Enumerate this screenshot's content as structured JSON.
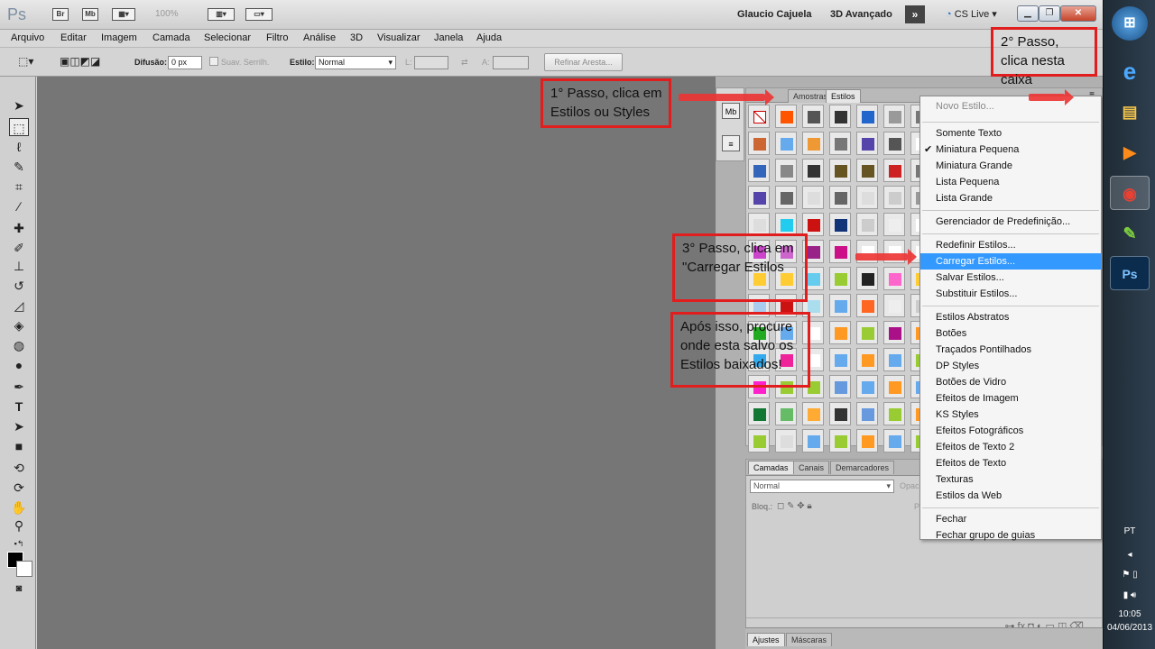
{
  "titlebar": {
    "app_logo": "Ps",
    "bridge": "Br",
    "minibridge": "Mb",
    "zoom": "100%",
    "user": "Glaucio Cajuela",
    "workspace": "3D Avançado",
    "more": "»",
    "cslive": "CS Live"
  },
  "menubar": [
    "Arquivo",
    "Editar",
    "Imagem",
    "Camada",
    "Selecionar",
    "Filtro",
    "Análise",
    "3D",
    "Visualizar",
    "Janela",
    "Ajuda"
  ],
  "options": {
    "difusao_label": "Difusão:",
    "difusao_value": "0 px",
    "suav_label": "Suav. Serrilh.",
    "estilo_label": "Estilo:",
    "estilo_value": "Normal",
    "l_label": "L:",
    "a_label": "A:",
    "refinar": "Refinar Aresta..."
  },
  "styles_panel": {
    "tabs": [
      "Amostras",
      "Estilos"
    ],
    "active_tab": "Estilos"
  },
  "layers_panel": {
    "tabs": [
      "Camadas",
      "Canais",
      "Demarcadores"
    ],
    "blend": "Normal",
    "opacity_label": "Opac",
    "lock_label": "Bloq.:",
    "preen": "P"
  },
  "adjust_tabs": [
    "Ajustes",
    "Máscaras"
  ],
  "menu": {
    "groups": [
      [
        {
          "label": "Novo Estilo...",
          "disabled": true
        }
      ],
      [
        {
          "label": "Somente Texto"
        },
        {
          "label": "Miniatura Pequena",
          "checked": true
        },
        {
          "label": "Miniatura Grande"
        },
        {
          "label": "Lista Pequena"
        },
        {
          "label": "Lista Grande"
        }
      ],
      [
        {
          "label": "Gerenciador de Predefinição..."
        }
      ],
      [
        {
          "label": "Redefinir Estilos..."
        },
        {
          "label": "Carregar Estilos...",
          "highlighted": true
        },
        {
          "label": "Salvar Estilos..."
        },
        {
          "label": "Substituir Estilos..."
        }
      ],
      [
        {
          "label": "Estilos Abstratos"
        },
        {
          "label": "Botões"
        },
        {
          "label": "Traçados Pontilhados"
        },
        {
          "label": "DP Styles"
        },
        {
          "label": "Botões de Vidro"
        },
        {
          "label": "Efeitos de Imagem"
        },
        {
          "label": "KS Styles"
        },
        {
          "label": "Efeitos Fotográficos"
        },
        {
          "label": "Efeitos de Texto 2"
        },
        {
          "label": "Efeitos de Texto"
        },
        {
          "label": "Texturas"
        },
        {
          "label": "Estilos da Web"
        }
      ],
      [
        {
          "label": "Fechar"
        },
        {
          "label": "Fechar grupo de guias"
        }
      ]
    ],
    "check_mark": "✔"
  },
  "annotations": {
    "step1": "1° Passo, clica em Estilos ou Styles",
    "step2": "2° Passo, clica nesta caixa",
    "step3": "3° Passo, clica em \"Carregar Estilos",
    "step4": "Após isso, procure onde esta salvo os Estilos baixados!",
    "color": "#e11d1d"
  },
  "taskbar": {
    "lang": "PT",
    "time": "10:05",
    "date": "04/06/2013",
    "apps": [
      "windows-orb",
      "ie",
      "explorer",
      "media-player",
      "chrome",
      "evernote",
      "photoshop"
    ]
  },
  "swatch_colors": [
    [
      "#ffffff",
      "#ff5500",
      "#555555",
      "#333333",
      "#2266cc",
      "#999999",
      "#777777"
    ],
    [
      "#cc6633",
      "#66aaee",
      "#ee9933",
      "#777777",
      "#5544aa",
      "#555555",
      "#ffffff"
    ],
    [
      "#3366bb",
      "#888888",
      "#333333",
      "#665522",
      "#665522",
      "#cc2222",
      "#777777"
    ],
    [
      "#5544aa",
      "#666666",
      "#dddddd",
      "#666666",
      "#dddddd",
      "#cccccc",
      "#999999"
    ],
    [
      "#dddddd",
      "#22ccee",
      "#cc1111",
      "#113377",
      "#cccccc",
      "#eeeeee",
      "#ffffff"
    ],
    [
      "#cc44cc",
      "#cc66cc",
      "#992288",
      "#cc1188",
      "#ffffff",
      "#ffffff",
      "#ffffff"
    ],
    [
      "#ffcc33",
      "#ffcc33",
      "#66ccee",
      "#99cc33",
      "#222222",
      "#ff66cc",
      "#ffcc33"
    ],
    [
      "#aaccee",
      "#cc1111",
      "#aaddee",
      "#66aaee",
      "#ff6622",
      "#eeeeee",
      "#cccccc"
    ],
    [
      "#22aa22",
      "#66aaee",
      "#ffffff",
      "#ff9922",
      "#99cc33",
      "#aa1188",
      "#ff9922"
    ],
    [
      "#33aaee",
      "#ee2299",
      "#ffffff",
      "#66aaee",
      "#ff9922",
      "#66aaee",
      "#99cc33"
    ],
    [
      "#ff22cc",
      "#99cc33",
      "#99cc33",
      "#6699dd",
      "#66aaee",
      "#ff9922",
      "#66aaee"
    ],
    [
      "#117733",
      "#66bb66",
      "#ffaa33",
      "#333333",
      "#6699dd",
      "#99cc33",
      "#ff9922"
    ],
    [
      "#99cc33",
      "#dddddd",
      "#66aaee",
      "#99cc33",
      "#ff9922",
      "#66aaee",
      "#99cc33"
    ]
  ]
}
